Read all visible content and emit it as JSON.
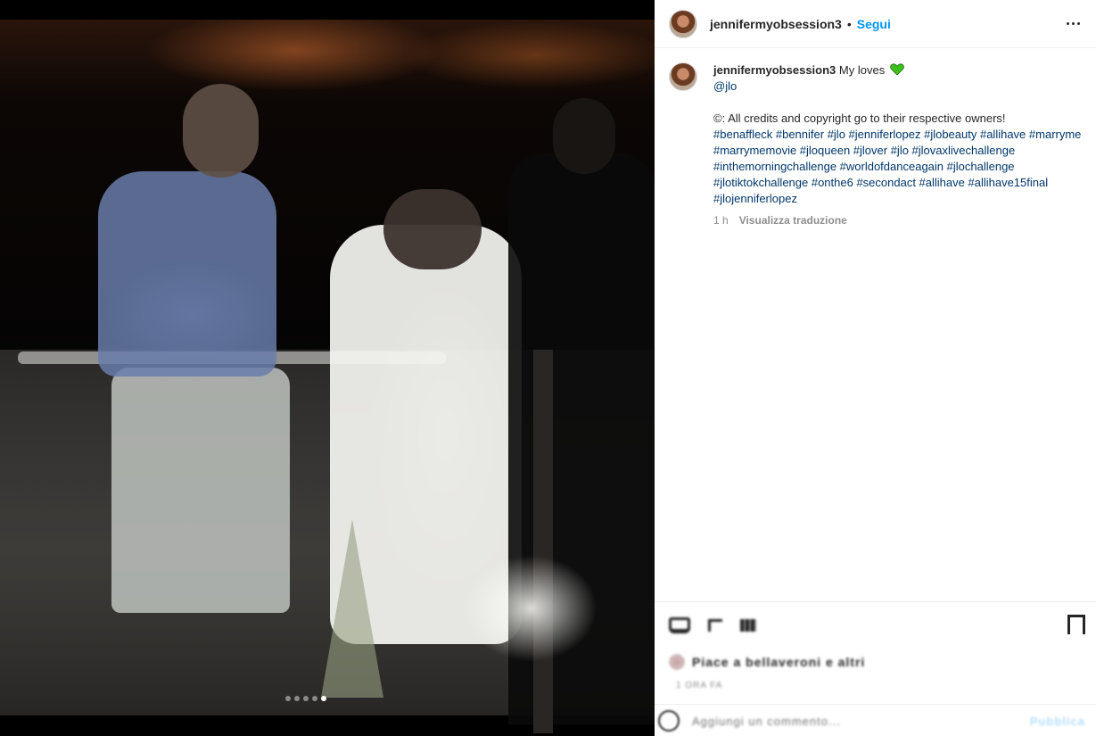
{
  "post": {
    "author": "jennifermyobsession3",
    "separator": "•",
    "follow_label": "Segui",
    "carousel_total": 5,
    "carousel_active_index": 5
  },
  "caption": {
    "author": "jennifermyobsession3",
    "text": "My loves",
    "heart_emoji": "green-heart",
    "mention": "@jlo",
    "credits": "©: All credits and copyright go to their respective owners!",
    "hashtags": "#benaffleck #bennifer #jlo #jenniferlopez #jlobeauty #allihave #marryme #marrymemovie #jloqueen #jlover #jlo #jlovaxlivechallenge #inthemorningchallenge #worldofdanceagain #jlochallenge #jlotiktokchallenge #onthe6 #secondact #allihave #allihave15final #jlojenniferlopez",
    "time": "1 h",
    "translate_label": "Visualizza traduzione"
  },
  "footer": {
    "likes_text": "Piace a bellaveroni e altri",
    "timestamp": "1 ORA FA",
    "comment_placeholder": "Aggiungi un commento...",
    "publish_label": "Pubblica"
  },
  "colors": {
    "accent": "#0095f6",
    "link": "#00376b",
    "muted": "#8e8e8e",
    "heart": "#3ec11c"
  }
}
